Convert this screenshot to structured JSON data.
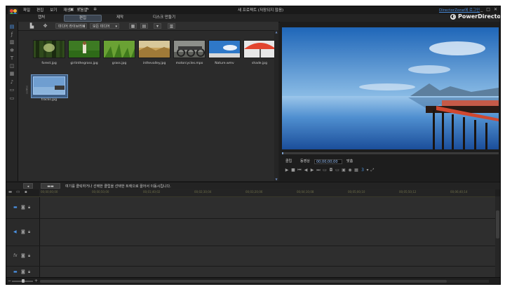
{
  "menu": [
    "파일",
    "편집",
    "보기",
    "재생",
    "도움말"
  ],
  "quick_icons": [
    "save-icon",
    "undo-icon",
    "redo-icon",
    "settings-icon"
  ],
  "document_title": "새 프로젝트 (저장되지 않음)",
  "upgrade_link": "DirectorZone에 로그인",
  "window_buttons": [
    "_",
    "□",
    "✕"
  ],
  "modes": [
    "캡처",
    "편집",
    "제작",
    "디스크 만들기"
  ],
  "active_mode": "편집",
  "brand": "PowerDirector",
  "library": {
    "dropdown_media": "미디어 라이브러리",
    "dropdown_filter": "모든 미디어",
    "items": [
      {
        "label": "forest.jpg"
      },
      {
        "label": "girlinthegrass.jpg"
      },
      {
        "label": "grass.jpg"
      },
      {
        "label": "inthevalley.jpg"
      },
      {
        "label": "motorcycles.mpo"
      },
      {
        "label": "Nature.wmv"
      },
      {
        "label": "shade.jpg"
      },
      {
        "label": "tracks.jpg"
      }
    ]
  },
  "preview": {
    "mode_clip": "클립",
    "mode_movie": "동영상",
    "timecode": "00;00;00;00",
    "fit_label": "맞춤"
  },
  "hint_text": "여기를 클릭하거나 선택한 클립을 선택한 트랙으로 끌어서 이동시킵니다.",
  "ruler_ticks": [
    "00;00;00;00",
    "00;00;50;00",
    "00;01;40;02",
    "00;02;30;04",
    "00;03;20;06",
    "00;04;10;08",
    "00;05;00;10",
    "00;05;50;12",
    "00;06;40;14"
  ],
  "tracks": [
    {
      "icon": "video-track-icon",
      "glyph": "▬"
    },
    {
      "icon": "audio-track-icon",
      "glyph": "◀"
    },
    {
      "icon": "fx-track-icon",
      "glyph": "fx"
    },
    {
      "icon": "video-track-icon",
      "glyph": "▬"
    }
  ],
  "colors": {
    "accent": "#4b93e6",
    "selection": "#3e5e84",
    "background": "#1f1f1f"
  }
}
